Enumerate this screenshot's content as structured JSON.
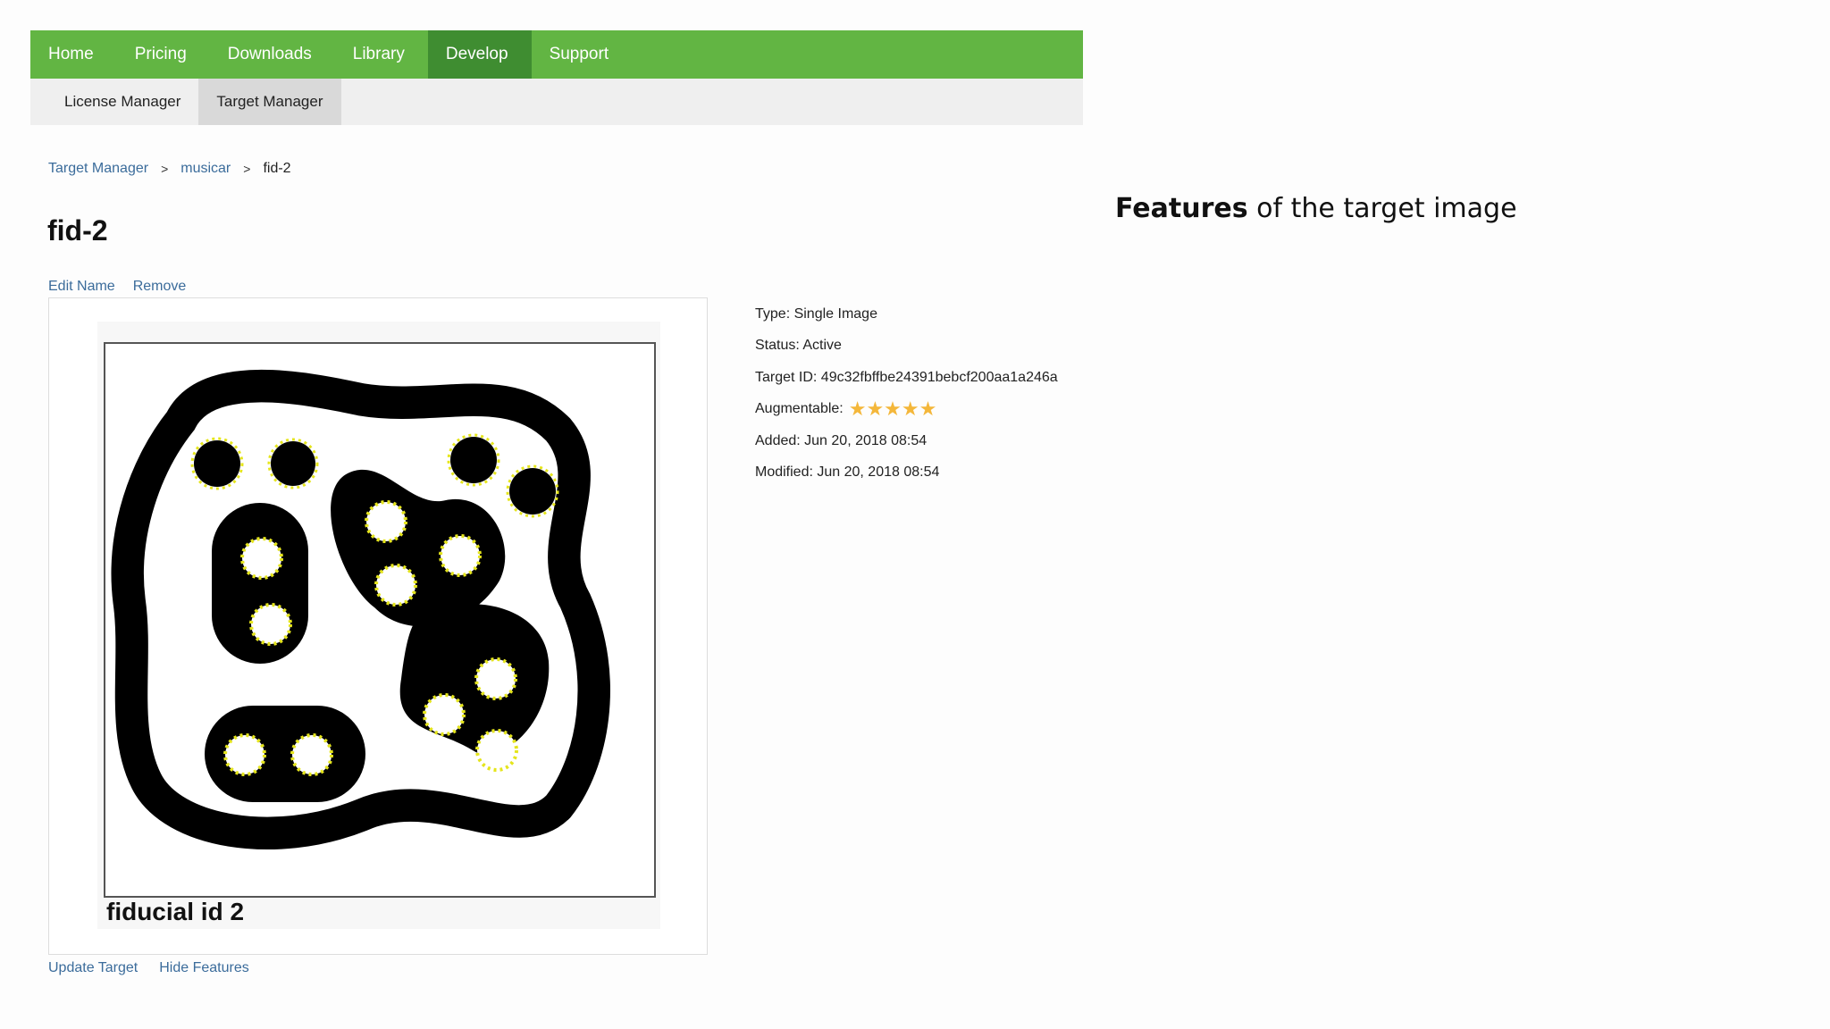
{
  "nav": {
    "items": [
      "Home",
      "Pricing",
      "Downloads",
      "Library",
      "Develop",
      "Support"
    ],
    "active_index": 4
  },
  "subnav": {
    "items": [
      "License Manager",
      "Target Manager"
    ],
    "active_index": 1
  },
  "breadcrumb": {
    "items": [
      "Target Manager",
      "musicar",
      "fid-2"
    ],
    "separator": ">"
  },
  "target": {
    "name": "fid-2",
    "image_caption": "fiducial id 2"
  },
  "actions": {
    "edit_name": "Edit Name",
    "remove": "Remove",
    "update_target": "Update Target",
    "hide_features": "Hide Features"
  },
  "details": {
    "type": "Type: Single Image",
    "status": "Status: Active",
    "target_id": "Target ID: 49c32fbffbe24391bebcf200aa1a246a",
    "augmentable_label": "Augmentable:",
    "augmentable_stars": "★★★★★",
    "augmentable_rating": 5,
    "added": "Added: Jun 20, 2018 08:54",
    "modified": "Modified: Jun 20, 2018 08:54"
  },
  "caption": {
    "bold": "Features",
    "rest": " of the target image"
  },
  "colors": {
    "nav_bg": "#62b543",
    "nav_active": "#3f8d31",
    "link": "#3b6c9b",
    "star": "#f4b73a",
    "feature_marker": "#e5e51c"
  }
}
